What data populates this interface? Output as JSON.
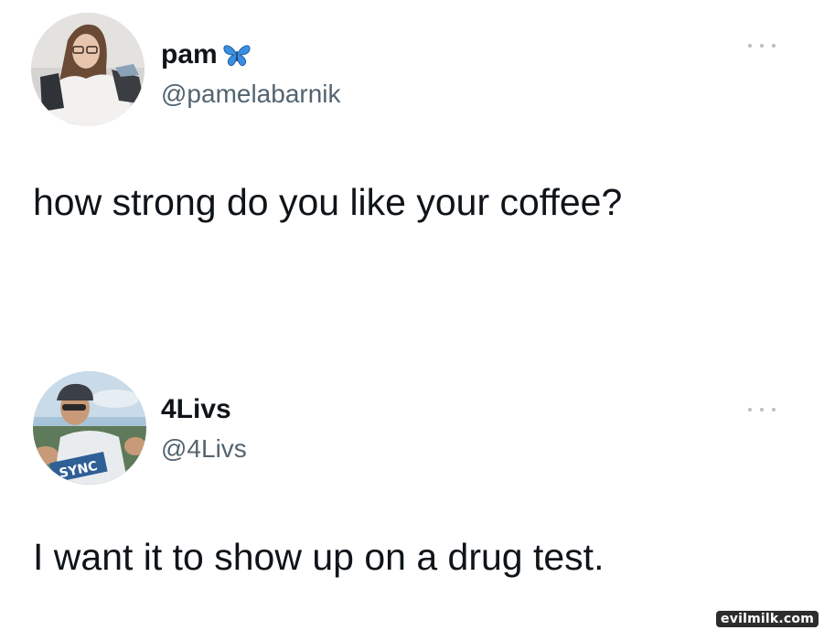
{
  "tweets": [
    {
      "display_name": "pam",
      "name_emoji": "blue-butterfly-icon",
      "handle": "@pamelabarnik",
      "text": "how strong do you like your coffee?"
    },
    {
      "display_name": "4Livs",
      "handle": "@4Livs",
      "text": "I want it to show up on a drug test."
    }
  ],
  "watermark": "evilmilk.com",
  "colors": {
    "text": "#0f1419",
    "handle": "#536471",
    "more_dots": "#b8bec4",
    "butterfly": "#3a8fe0"
  }
}
